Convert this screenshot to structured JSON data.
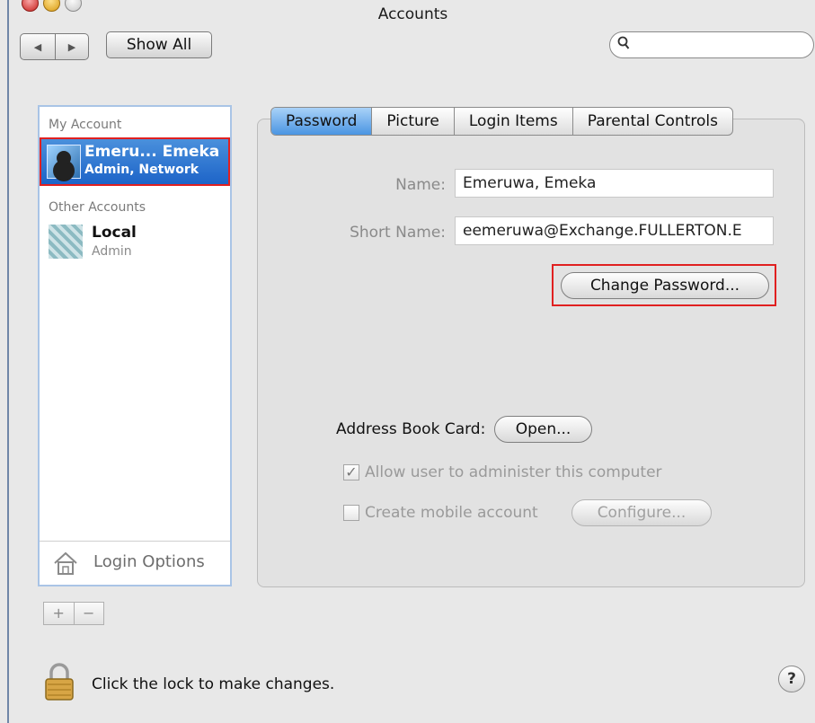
{
  "window": {
    "title": "Accounts"
  },
  "toolbar": {
    "back_icon": "◀",
    "forward_icon": "▶",
    "show_all_label": "Show All",
    "search_icon": "⚲",
    "search_value": ""
  },
  "sidebar": {
    "my_account_heading": "My Account",
    "my_account": {
      "name": "Emeru... Emeka",
      "role": "Admin, Network"
    },
    "other_accounts_heading": "Other Accounts",
    "other_accounts": [
      {
        "name": "Local",
        "role": "Admin"
      }
    ],
    "login_options_label": "Login Options",
    "add_label": "+",
    "remove_label": "−"
  },
  "tabs": [
    {
      "label": "Password"
    },
    {
      "label": "Picture"
    },
    {
      "label": "Login Items"
    },
    {
      "label": "Parental Controls"
    }
  ],
  "password_tab": {
    "name_label": "Name:",
    "name_value": "Emeruwa, Emeka",
    "short_name_label": "Short Name:",
    "short_name_value": "eemeruwa@Exchange.FULLERTON.E",
    "change_password_label": "Change Password...",
    "address_book_label": "Address Book Card:",
    "open_label": "Open...",
    "admin_checkbox_label": "Allow user to administer this computer",
    "admin_checked": true,
    "mobile_checkbox_label": "Create mobile account",
    "mobile_checked": false,
    "configure_label": "Configure..."
  },
  "footer": {
    "lock_text": "Click the lock to make changes.",
    "help_label": "?"
  },
  "colors": {
    "highlight": "#e02020",
    "selection": "#1d64c8"
  }
}
